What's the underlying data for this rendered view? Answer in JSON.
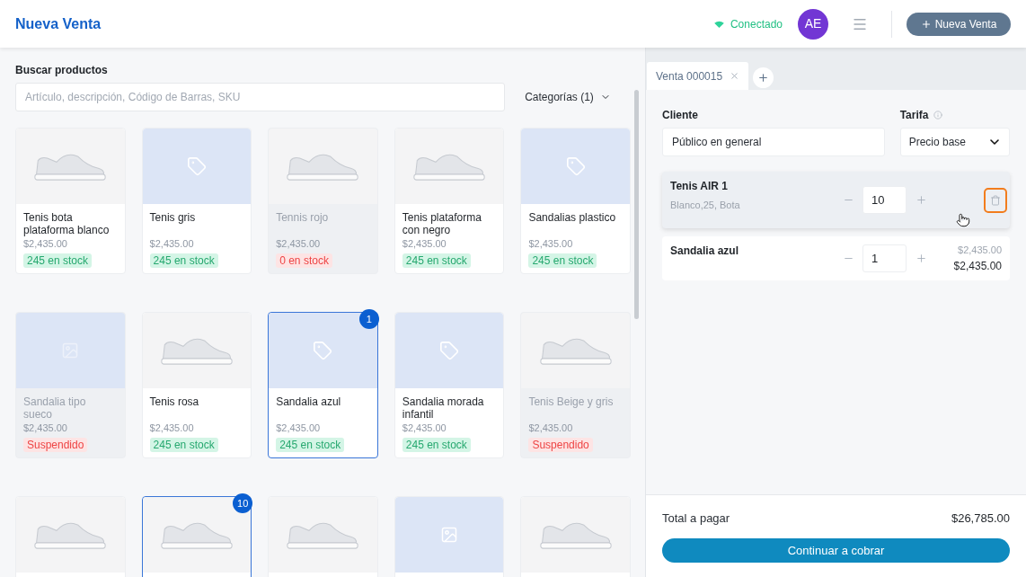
{
  "header": {
    "title": "Nueva Venta",
    "connection": {
      "label": "Conectado",
      "online": true
    },
    "avatar": {
      "initials": "AE"
    },
    "new_sale_button": {
      "label": "Nueva Venta"
    }
  },
  "search": {
    "label": "Buscar productos",
    "placeholder": "Artículo, descripción, Código de Barras, SKU",
    "category_filter": {
      "label": "Categorías (1)"
    }
  },
  "products": [
    {
      "kind": "photo",
      "name": "Tenis bota plataforma blanco",
      "price": "$2,435.00",
      "stock": {
        "text": "245 en stock",
        "kind": "available"
      },
      "disabled": false,
      "selected": false
    },
    {
      "kind": "tag",
      "name": "Tenis gris",
      "price": "$2,435.00",
      "stock": {
        "text": "245 en stock",
        "kind": "available"
      },
      "disabled": false,
      "selected": false
    },
    {
      "kind": "photo",
      "name": "Tennis rojo",
      "price": "$2,435.00",
      "stock": {
        "text": "0 en stock",
        "kind": "out"
      },
      "disabled": true,
      "selected": false
    },
    {
      "kind": "photo",
      "name": "Tenis plataforma con negro",
      "price": "$2,435.00",
      "stock": {
        "text": "245 en stock",
        "kind": "available"
      },
      "disabled": false,
      "selected": false
    },
    {
      "kind": "tag",
      "name": "Sandalias plastico",
      "price": "$2,435.00",
      "stock": {
        "text": "245 en stock",
        "kind": "available"
      },
      "disabled": false,
      "selected": false
    },
    {
      "kind": "placeholder",
      "name": "Sandalia tipo sueco",
      "price": "$2,435.00",
      "stock": {
        "text": "Suspendido",
        "kind": "suspended"
      },
      "disabled": true,
      "selected": false
    },
    {
      "kind": "photo",
      "name": "Tenis rosa",
      "price": "$2,435.00",
      "stock": {
        "text": "245 en stock",
        "kind": "available"
      },
      "disabled": false,
      "selected": false
    },
    {
      "kind": "tag",
      "name": "Sandalia azul",
      "price": "$2,435.00",
      "stock": {
        "text": "245 en stock",
        "kind": "available"
      },
      "disabled": false,
      "selected": true,
      "count": "1"
    },
    {
      "kind": "tag",
      "name": "Sandalia morada infantil",
      "price": "$2,435.00",
      "stock": {
        "text": "245 en stock",
        "kind": "available"
      },
      "disabled": false,
      "selected": false
    },
    {
      "kind": "photo",
      "name": "Tenis Beige y gris",
      "price": "$2,435.00",
      "stock": {
        "text": "Suspendido",
        "kind": "suspended"
      },
      "disabled": true,
      "selected": false
    },
    {
      "kind": "photo",
      "disabled": false,
      "selected": false
    },
    {
      "kind": "photo",
      "disabled": false,
      "selected": true,
      "count": "10"
    },
    {
      "kind": "photo",
      "disabled": false,
      "selected": false
    },
    {
      "kind": "placeholder",
      "disabled": false,
      "selected": false
    },
    {
      "kind": "photo",
      "disabled": false,
      "selected": false
    }
  ],
  "sale": {
    "tabs": [
      {
        "label": "Venta 000015",
        "selected": true
      }
    ],
    "client": {
      "label": "Cliente",
      "value": "Público en general"
    },
    "rate": {
      "label": "Tarifa",
      "value": "Precio base"
    },
    "items": [
      {
        "name": "Tenis AIR 1",
        "variant": "Blanco,25, Bota",
        "quantity": "10",
        "highlighted": true
      },
      {
        "name": "Sandalia azul",
        "quantity": "1",
        "highlighted": false,
        "list_price": "$2,435.00",
        "price": "$2,435.00"
      }
    ],
    "total": {
      "label": "Total a pagar",
      "value": "$26,785.00"
    },
    "checkout_button": {
      "label": "Continuar a cobrar"
    }
  }
}
